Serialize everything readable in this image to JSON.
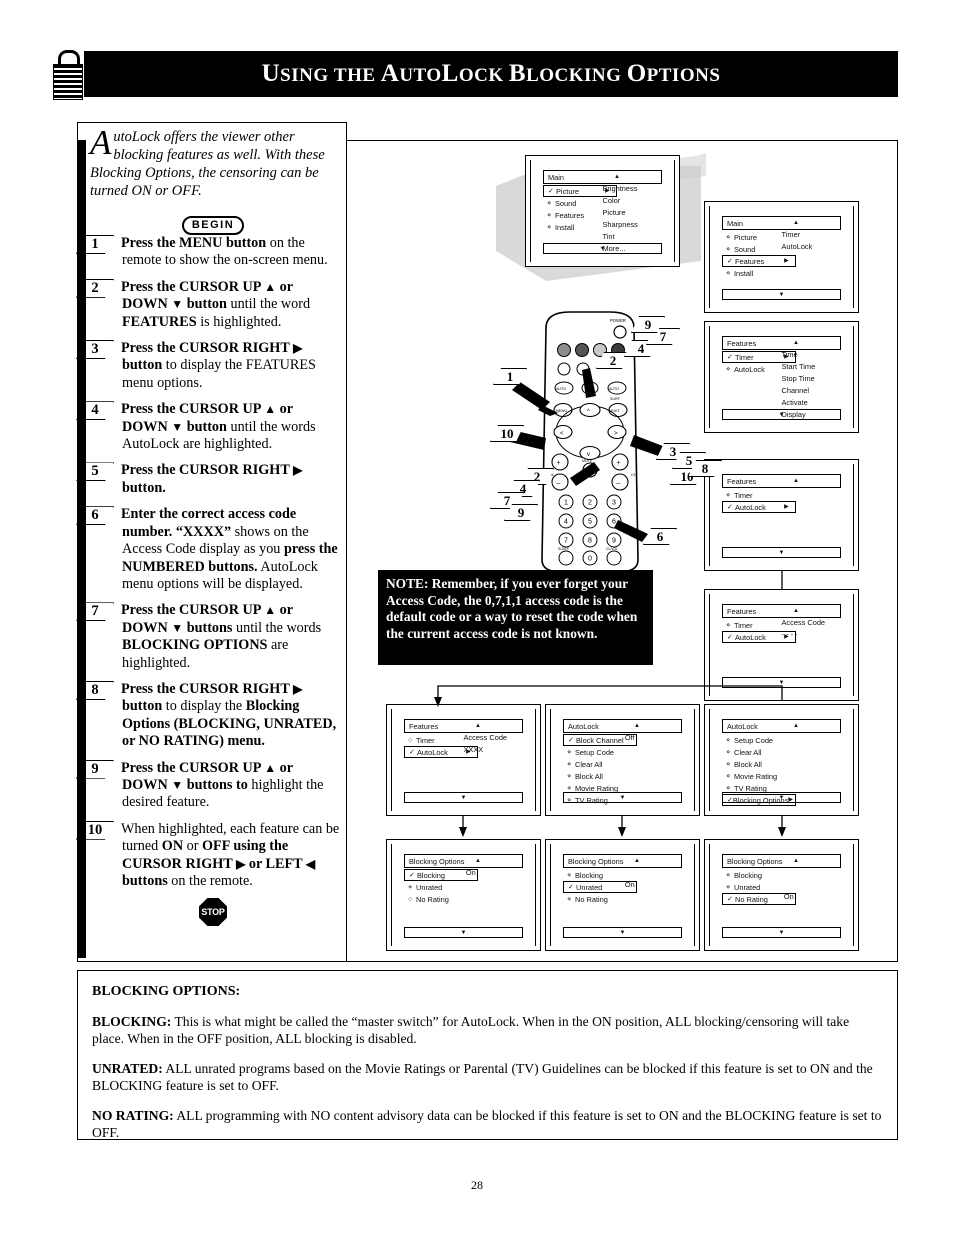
{
  "header": {
    "title_parts": [
      {
        "t": "U",
        "big": true
      },
      {
        "t": "SING",
        "big": false
      },
      {
        "t": " ",
        "big": false
      },
      {
        "t": "THE",
        "big": false
      },
      {
        "t": " ",
        "big": false
      },
      {
        "t": "A",
        "big": true
      },
      {
        "t": "UTO",
        "big": false
      },
      {
        "t": "L",
        "big": true
      },
      {
        "t": "OCK",
        "big": false
      },
      {
        "t": " ",
        "big": false
      },
      {
        "t": "B",
        "big": true
      },
      {
        "t": "LOCKING",
        "big": false
      },
      {
        "t": " ",
        "big": false
      },
      {
        "t": "O",
        "big": true
      },
      {
        "t": "PTIONS",
        "big": false
      }
    ],
    "title_plain": "USING THE AUTOLOCK BLOCKING OPTIONS",
    "icon": "padlock-icon"
  },
  "intro": {
    "dropcap": "A",
    "text": "utoLock offers the viewer other blocking features as well. With these Blocking Options, the censoring can be turned ON or OFF."
  },
  "badges": {
    "begin": "BEGIN",
    "stop": "STOP"
  },
  "steps": [
    {
      "num": "1",
      "html": "<b>Press the MENU button</b> on the remote to show the on-screen menu."
    },
    {
      "num": "2",
      "html": "<b>Press the CURSOR UP <span class=\"arr\">▲</span> or DOWN <span class=\"arr\">▼</span> button</b> until the word <b>FEATURES</b> is highlighted."
    },
    {
      "num": "3",
      "html": "<b>Press the CURSOR RIGHT <span class=\"arr\">▶</span> button</b> to display the FEATURES menu options."
    },
    {
      "num": "4",
      "html": "<b>Press the CURSOR UP <span class=\"arr\">▲</span> or DOWN <span class=\"arr\">▼</span> button</b> until the words AutoLock are highlighted."
    },
    {
      "num": "5",
      "html": "<b>Press the CURSOR RIGHT <span class=\"arr\">▶</span> button.</b>"
    },
    {
      "num": "6",
      "html": "<b>Enter the correct access code number. “XXXX”</b> shows on the Access Code display as you <b>press the NUMBERED buttons.</b> AutoLock menu options will be displayed."
    },
    {
      "num": "7",
      "html": "<b>Press the CURSOR UP <span class=\"arr\">▲</span> or DOWN <span class=\"arr\">▼</span> buttons</b> until the words <b>BLOCKING OPTIONS</b> are highlighted."
    },
    {
      "num": "8",
      "html": "<b>Press the CURSOR RIGHT <span class=\"arr\">▶</span> button</b> to display the <b>Blocking Options (BLOCKING, UNRATED, or NO RATING) menu.</b>"
    },
    {
      "num": "9",
      "html": "<b>Press the CURSOR UP <span class=\"arr\">▲</span> or DOWN <span class=\"arr\">▼</span> buttons to</b> highlight the desired feature."
    },
    {
      "num": "10",
      "html": "When highlighted, each feature can be turned <b>ON</b> or <b>OFF using the CURSOR RIGHT <span class=\"arr\">▶</span> or LEFT <span class=\"arr\">◀</span> buttons</b> on the remote."
    }
  ],
  "note": {
    "text": "NOTE: Remember, if you ever forget your Access Code, the 0,7,1,1 access code is the default code or a way to reset the code when the current access code is not known."
  },
  "remote": {
    "name": "tv-remote-control",
    "callouts": [
      "1",
      "2",
      "3",
      "4",
      "5",
      "6",
      "7",
      "9",
      "10"
    ],
    "power_label": "POWER",
    "keypad": [
      "1",
      "2",
      "3",
      "4",
      "5",
      "6",
      "7",
      "8",
      "9",
      "0"
    ],
    "button_labels": [
      "MENU",
      "EXIT",
      "CC",
      "AUTO PICTURE",
      "AUTO SOUND",
      "SURF",
      "STATUS",
      "VOL",
      "CH",
      "MUTE",
      "SLEEP",
      "CL/VOL"
    ]
  },
  "menus": [
    {
      "id": "menu-main-picture",
      "header": "Main",
      "items": [
        {
          "label": "Picture",
          "bullet": "check",
          "selected": true,
          "arrow": true
        },
        {
          "label": "Sound",
          "bullet": "diamond",
          "selected": false,
          "arrow": false
        },
        {
          "label": "Features",
          "bullet": "diamond",
          "selected": false,
          "arrow": false
        },
        {
          "label": "Install",
          "bullet": "diamond",
          "selected": false,
          "arrow": false
        }
      ],
      "right_column": [
        "Brightness",
        "Color",
        "Picture",
        "Sharpness",
        "Tint",
        "More..."
      ]
    },
    {
      "id": "menu-main-features",
      "header": "Main",
      "items": [
        {
          "label": "Picture",
          "bullet": "diamond",
          "selected": false,
          "arrow": false
        },
        {
          "label": "Sound",
          "bullet": "diamond",
          "selected": false,
          "arrow": false
        },
        {
          "label": "Features",
          "bullet": "check",
          "selected": true,
          "arrow": true
        },
        {
          "label": "Install",
          "bullet": "diamond",
          "selected": false,
          "arrow": false
        }
      ],
      "right_column": [
        "Timer",
        "AutoLock"
      ]
    },
    {
      "id": "menu-features-timer",
      "header": "Features",
      "items": [
        {
          "label": "Timer",
          "bullet": "check",
          "selected": true,
          "arrow": true
        },
        {
          "label": "AutoLock",
          "bullet": "diamond",
          "selected": false,
          "arrow": false
        }
      ],
      "right_column": [
        "Time",
        "Start Time",
        "Stop Time",
        "Channel",
        "Activate",
        "Display"
      ]
    },
    {
      "id": "menu-features-autolock",
      "header": "Features",
      "items": [
        {
          "label": "Timer",
          "bullet": "diamond",
          "selected": false,
          "arrow": false
        },
        {
          "label": "AutoLock",
          "bullet": "check",
          "selected": true,
          "arrow": true
        }
      ],
      "right_column": []
    },
    {
      "id": "menu-features-access-code-blank",
      "header": "Features",
      "items": [
        {
          "label": "Timer",
          "bullet": "diamond",
          "selected": false,
          "arrow": false
        },
        {
          "label": "AutoLock",
          "bullet": "check",
          "selected": true,
          "arrow": true
        }
      ],
      "right_column": [
        "Access Code",
        "- - - -"
      ]
    },
    {
      "id": "menu-features-access-code-xxxx",
      "header": "Features",
      "items": [
        {
          "label": "Timer",
          "bullet": "circle",
          "selected": false,
          "arrow": false
        },
        {
          "label": "AutoLock",
          "bullet": "check",
          "selected": true,
          "arrow": true
        }
      ],
      "right_column": [
        "Access Code",
        "XXXX"
      ]
    },
    {
      "id": "menu-autolock-top",
      "header": "AutoLock",
      "items": [
        {
          "label": "Block Channel",
          "bullet": "check",
          "selected": true,
          "arrow": false,
          "value": "Off"
        },
        {
          "label": "Setup Code",
          "bullet": "diamond",
          "selected": false,
          "arrow": false
        },
        {
          "label": "Clear All",
          "bullet": "diamond",
          "selected": false,
          "arrow": false
        },
        {
          "label": "Block All",
          "bullet": "diamond",
          "selected": false,
          "arrow": false
        },
        {
          "label": "Movie Rating",
          "bullet": "diamond",
          "selected": false,
          "arrow": false
        },
        {
          "label": "TV Rating",
          "bullet": "diamond",
          "selected": false,
          "arrow": false
        }
      ],
      "right_column": []
    },
    {
      "id": "menu-autolock-blocking-options",
      "header": "AutoLock",
      "items": [
        {
          "label": "Setup Code",
          "bullet": "diamond",
          "selected": false,
          "arrow": false
        },
        {
          "label": "Clear All",
          "bullet": "diamond",
          "selected": false,
          "arrow": false
        },
        {
          "label": "Block All",
          "bullet": "diamond",
          "selected": false,
          "arrow": false
        },
        {
          "label": "Movie Rating",
          "bullet": "diamond",
          "selected": false,
          "arrow": false
        },
        {
          "label": "TV Rating",
          "bullet": "diamond",
          "selected": false,
          "arrow": false
        },
        {
          "label": "Blocking Options",
          "bullet": "check",
          "selected": true,
          "arrow": true
        }
      ],
      "right_column": []
    },
    {
      "id": "menu-blocking-options-blocking",
      "header": "Blocking Options",
      "items": [
        {
          "label": "Blocking",
          "bullet": "check",
          "selected": true,
          "arrow": false,
          "value": "On"
        },
        {
          "label": "Unrated",
          "bullet": "diamond",
          "selected": false,
          "arrow": false
        },
        {
          "label": "No Rating",
          "bullet": "circle",
          "selected": false,
          "arrow": false
        }
      ],
      "right_column": []
    },
    {
      "id": "menu-blocking-options-unrated",
      "header": "Blocking Options",
      "items": [
        {
          "label": "Blocking",
          "bullet": "diamond",
          "selected": false,
          "arrow": false
        },
        {
          "label": "Unrated",
          "bullet": "check",
          "selected": true,
          "arrow": false,
          "value": "On"
        },
        {
          "label": "No Rating",
          "bullet": "diamond",
          "selected": false,
          "arrow": false
        }
      ],
      "right_column": []
    },
    {
      "id": "menu-blocking-options-no-rating",
      "header": "Blocking Options",
      "items": [
        {
          "label": "Blocking",
          "bullet": "diamond",
          "selected": false,
          "arrow": false
        },
        {
          "label": "Unrated",
          "bullet": "diamond",
          "selected": false,
          "arrow": false
        },
        {
          "label": "No Rating",
          "bullet": "check",
          "selected": true,
          "arrow": false,
          "value": "On"
        }
      ],
      "right_column": []
    }
  ],
  "explanation": {
    "heading": "BLOCKING OPTIONS:",
    "paragraphs": [
      {
        "term": "BLOCKING:",
        "body": " This is what might be called the “master switch” for AutoLock. When in the ON position, ALL blocking/censoring will take place. When in the OFF position, ALL blocking is disabled."
      },
      {
        "term": "UNRATED:",
        "body": " ALL unrated programs based on the Movie Ratings or Parental (TV) Guidelines can be blocked if this feature is set to ON and the BLOCKING feature is set to OFF."
      },
      {
        "term": "NO RATING:",
        "body": " ALL programming with NO content advisory data can be blocked if this feature is set to ON and the BLOCKING feature is set to OFF."
      }
    ]
  },
  "page_number": "28"
}
